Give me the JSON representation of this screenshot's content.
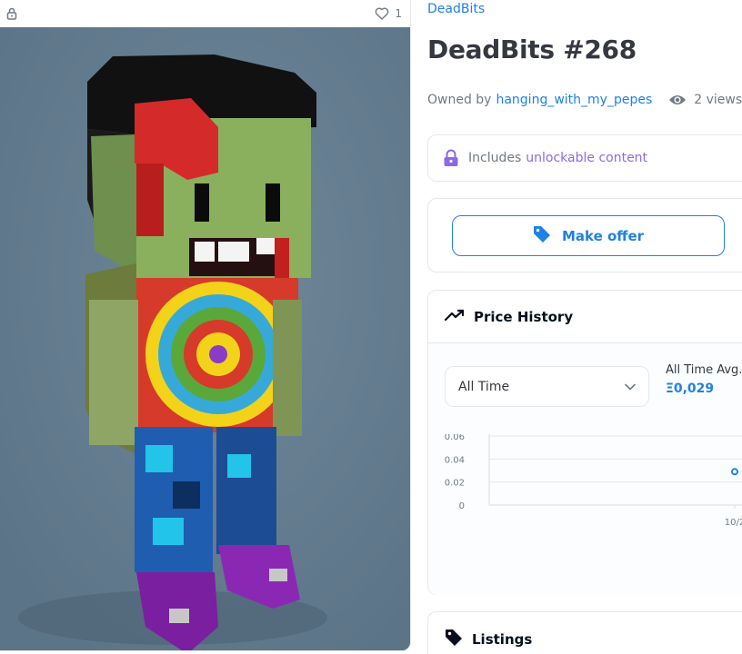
{
  "media": {
    "favorite_count": "1"
  },
  "asset": {
    "collection": "DeadBits",
    "title": "DeadBits #268",
    "owned_by_label": "Owned by",
    "owner": "hanging_with_my_pepes",
    "views": "2 views"
  },
  "unlockable": {
    "prefix": "Includes",
    "link": "unlockable content"
  },
  "offer": {
    "button_label": "Make offer"
  },
  "price_history": {
    "title": "Price History",
    "period": "All Time",
    "avg_label": "All Time Avg.",
    "avg_value": "Ξ0,029"
  },
  "chart_data": {
    "type": "scatter",
    "ylim": [
      0,
      0.06
    ],
    "yticks": [
      "0",
      "0.02",
      "0.04",
      "0.06"
    ],
    "xticks": [
      "10/2"
    ],
    "points": [
      {
        "x": "10/2",
        "y": 0.029
      }
    ],
    "grid": true
  },
  "listings": {
    "title": "Listings"
  },
  "colors": {
    "accent": "#2081e2",
    "unlockable": "#8c6ae6",
    "image_background": "#667e92"
  }
}
